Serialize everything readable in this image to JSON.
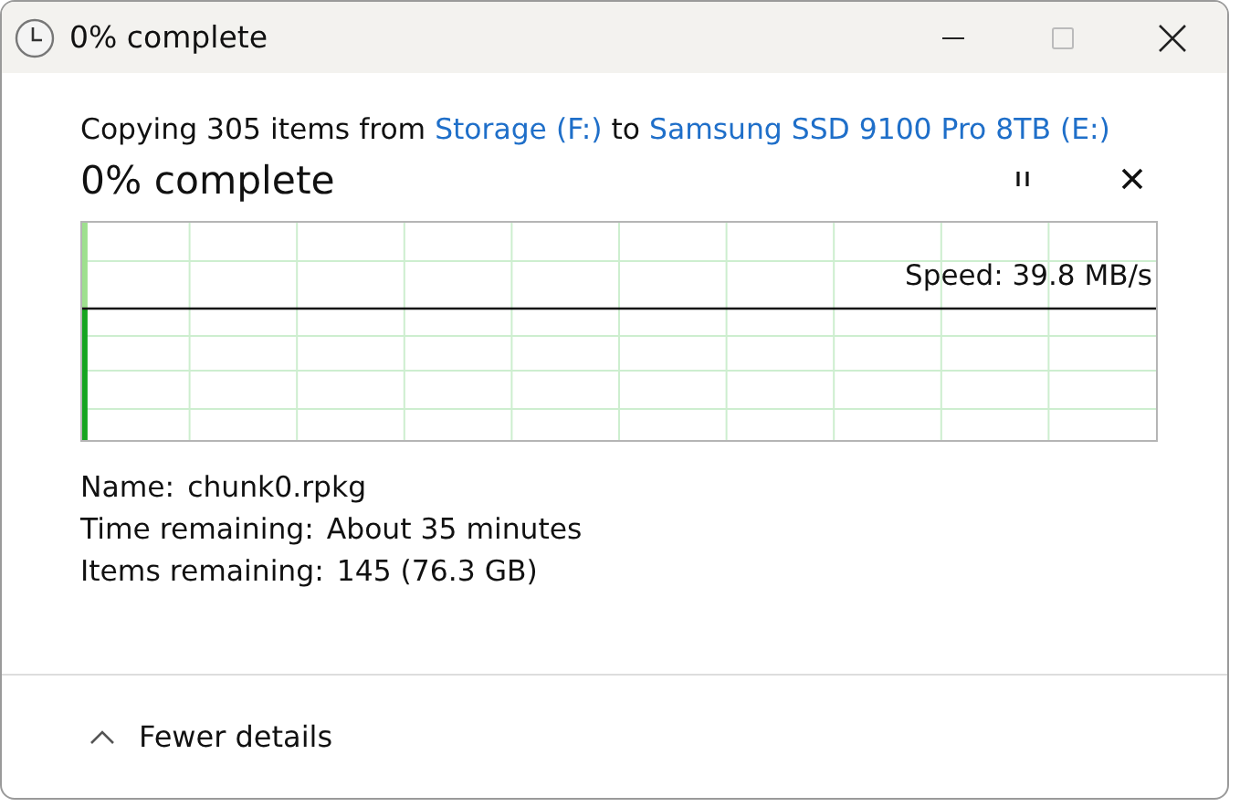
{
  "window": {
    "title": "0% complete"
  },
  "copy_line": {
    "prefix": "Copying 305 items from",
    "source": "Storage (F:)",
    "joiner": "to",
    "destination": "Samsung SSD 9100 Pro 8TB (E:)"
  },
  "progress": {
    "heading": "0% complete",
    "level": 0.005,
    "speed": "Speed: 39.8 MB/s"
  },
  "details": [
    {
      "label": "Name:",
      "value": "chunk0.rpkg"
    },
    {
      "label": "Time remaining:",
      "value": "About 35 minutes"
    },
    {
      "label": "Items remaining:",
      "value": "145 (76.3 GB)"
    }
  ],
  "toggle": {
    "label": "Fewer details",
    "expanded": true
  }
}
